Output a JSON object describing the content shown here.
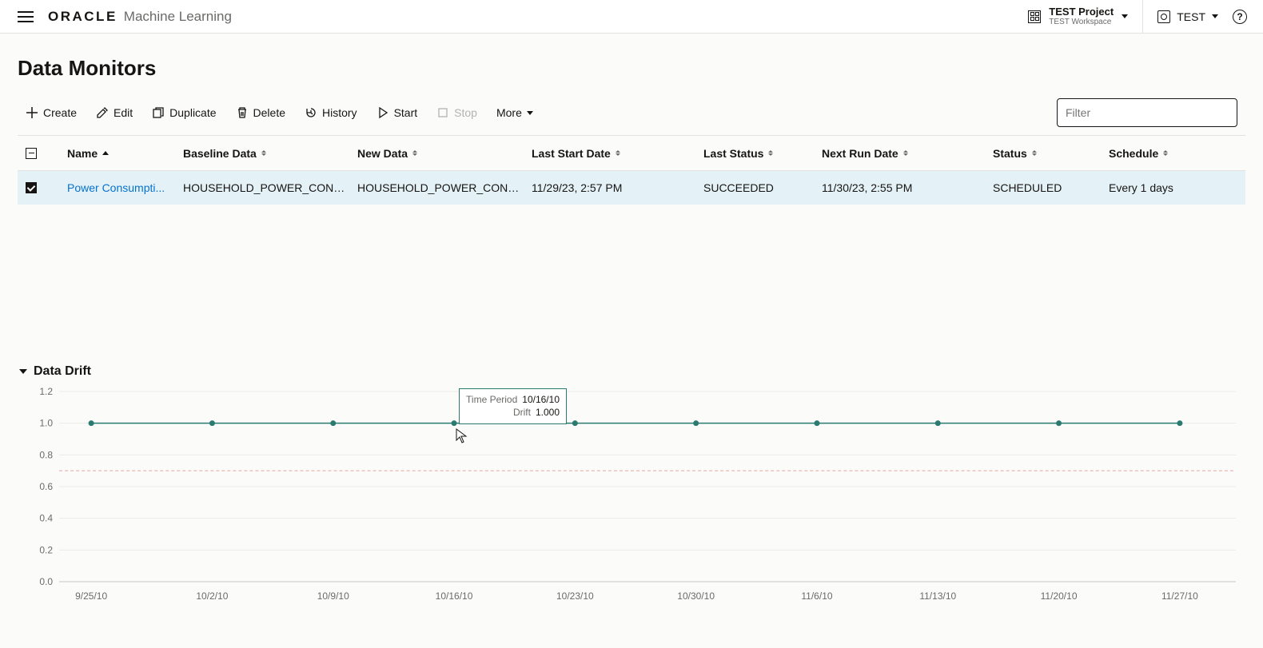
{
  "header": {
    "logo": "ORACLE",
    "product": "Machine Learning",
    "project_name": "TEST Project",
    "workspace": "TEST Workspace",
    "user": "TEST"
  },
  "page": {
    "title": "Data Monitors"
  },
  "toolbar": {
    "create": "Create",
    "edit": "Edit",
    "duplicate": "Duplicate",
    "delete": "Delete",
    "history": "History",
    "start": "Start",
    "stop": "Stop",
    "more": "More",
    "filter_placeholder": "Filter"
  },
  "table": {
    "headers": {
      "name": "Name",
      "baseline": "Baseline Data",
      "newdata": "New Data",
      "last_start": "Last Start Date",
      "last_status": "Last Status",
      "next_run": "Next Run Date",
      "status": "Status",
      "schedule": "Schedule"
    },
    "rows": [
      {
        "name": "Power Consumpti...",
        "baseline": "HOUSEHOLD_POWER_CONS...",
        "newdata": "HOUSEHOLD_POWER_CONS...",
        "last_start": "11/29/23, 2:57 PM",
        "last_status": "SUCCEEDED",
        "next_run": "11/30/23, 2:55 PM",
        "status": "SCHEDULED",
        "schedule": "Every 1 days"
      }
    ]
  },
  "section": {
    "title": "Data Drift"
  },
  "tooltip": {
    "k1": "Time Period",
    "v1": "10/16/10",
    "k2": "Drift",
    "v2": "1.000"
  },
  "chart_data": {
    "type": "line",
    "ylabel": "",
    "xlabel": "",
    "ylim": [
      0.0,
      1.2
    ],
    "y_ticks": [
      0.0,
      0.2,
      0.4,
      0.6,
      0.8,
      1.0,
      1.2
    ],
    "threshold": 0.7,
    "x": [
      "9/25/10",
      "10/2/10",
      "10/9/10",
      "10/16/10",
      "10/23/10",
      "10/30/10",
      "11/6/10",
      "11/13/10",
      "11/20/10",
      "11/27/10"
    ],
    "values": [
      1.0,
      1.0,
      1.0,
      1.0,
      1.0,
      1.0,
      1.0,
      1.0,
      1.0,
      1.0
    ],
    "highlight_index": 3
  }
}
